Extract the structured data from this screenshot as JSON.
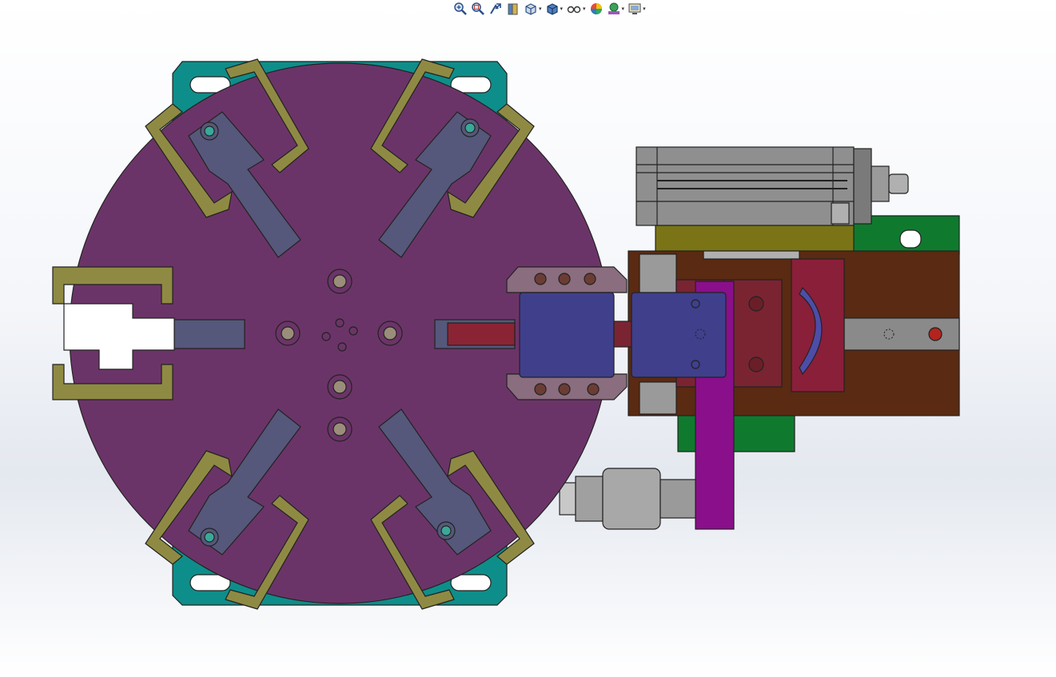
{
  "app": {
    "title": ""
  },
  "toolbar": {
    "items": [
      {
        "id": "zoom-to-fit",
        "icon": "zoom-to-fit-icon",
        "has_dropdown": false
      },
      {
        "id": "zoom-to-area",
        "icon": "zoom-to-area-icon",
        "has_dropdown": false
      },
      {
        "id": "previous-view",
        "icon": "previous-view-icon",
        "has_dropdown": false
      },
      {
        "id": "section-view",
        "icon": "section-view-icon",
        "has_dropdown": false
      },
      {
        "id": "view-orientation",
        "icon": "view-orientation-icon",
        "has_dropdown": true
      },
      {
        "id": "display-style",
        "icon": "display-style-icon",
        "has_dropdown": true
      },
      {
        "id": "hide-show-items",
        "icon": "hide-show-items-icon",
        "has_dropdown": true
      },
      {
        "id": "edit-appearance",
        "icon": "edit-appearance-icon",
        "has_dropdown": false
      },
      {
        "id": "apply-scene",
        "icon": "apply-scene-icon",
        "has_dropdown": true
      },
      {
        "id": "view-settings",
        "icon": "view-settings-icon",
        "has_dropdown": true
      }
    ],
    "dropdown_glyph": "▾"
  },
  "model": {
    "colors": {
      "turntable": "#6b3468",
      "base_plate": "#0e8e8a",
      "clamp_jaw": "#8f8a43",
      "finger": "#55587a",
      "cylinder_body": "#8f8f8f",
      "blue_block": "#3f3f8c",
      "brown_base": "#5a2a12",
      "green_plate": "#0f7a2e",
      "red_block": "#7a2432",
      "magenta_bar": "#8a0f8a",
      "olive_bracket": "#6f6a10",
      "steel_rod": "#6e6e6e"
    }
  }
}
